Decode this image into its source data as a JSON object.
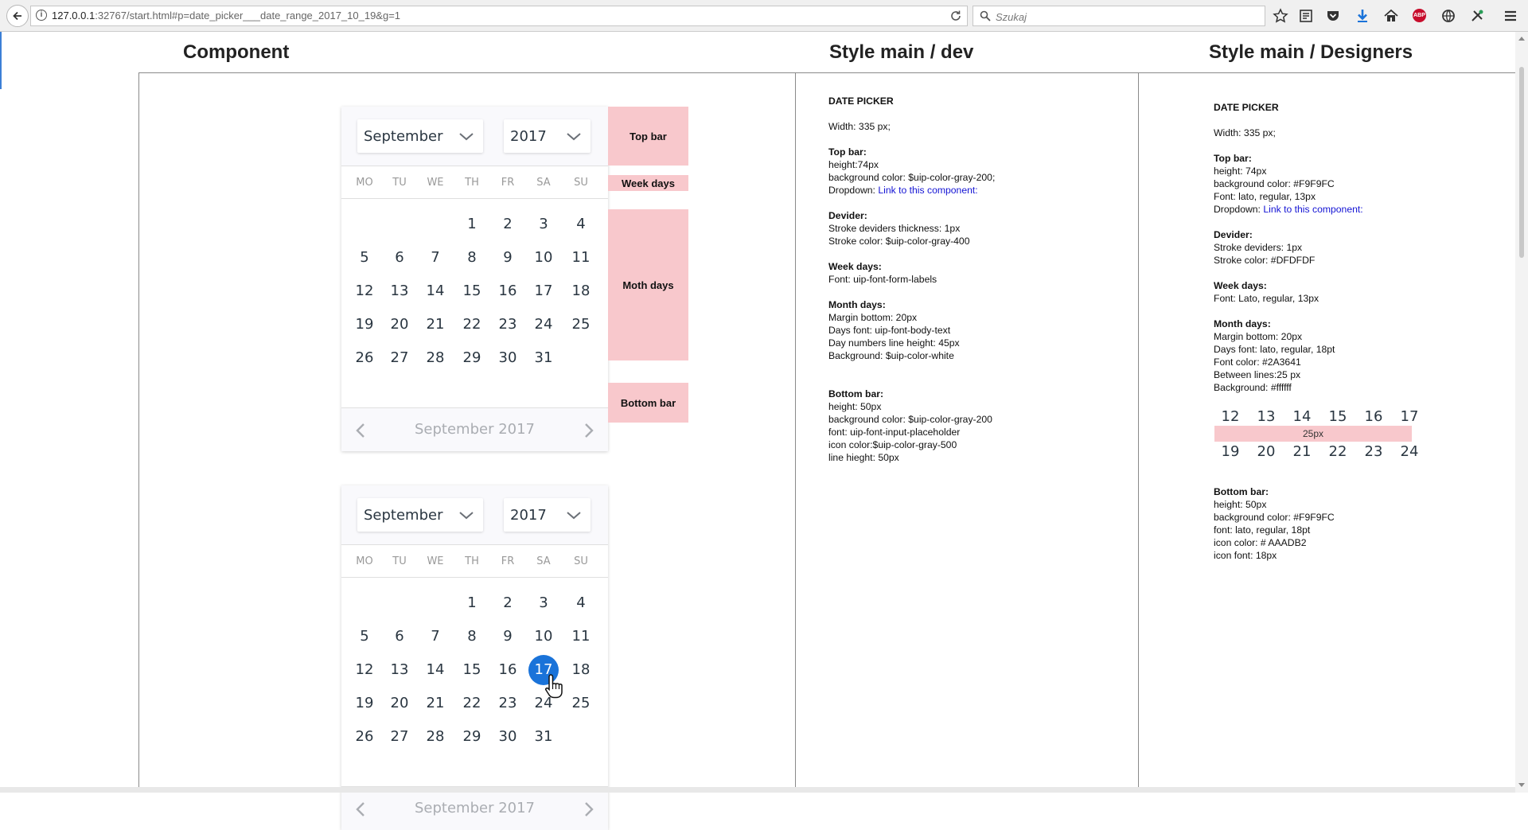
{
  "browser": {
    "url_host": "127.0.0.1",
    "url_rest": ":32767/start.html#p=date_picker___date_range_2017_10_19&g=1",
    "search_placeholder": "Szukaj",
    "icons": [
      "star-icon",
      "reader-icon",
      "pocket-icon",
      "download-icon",
      "home-icon",
      "adblock-icon",
      "vpn-icon",
      "tools-icon",
      "menu-icon"
    ],
    "adblock_label": "ABP"
  },
  "columns": {
    "component": "Component",
    "dev": "Style main / dev",
    "designers": "Style main / Designers"
  },
  "picker1": {
    "month": "September",
    "year": "2017",
    "weekdays": [
      "MO",
      "TU",
      "WE",
      "TH",
      "FR",
      "SA",
      "SU"
    ],
    "days": [
      "1",
      "2",
      "3",
      "4",
      "5",
      "6",
      "7",
      "8",
      "9",
      "10",
      "11",
      "12",
      "13",
      "14",
      "15",
      "16",
      "17",
      "18",
      "19",
      "20",
      "21",
      "22",
      "23",
      "24",
      "25",
      "26",
      "27",
      "28",
      "29",
      "30",
      "31"
    ],
    "footer": "September 2017"
  },
  "picker2": {
    "month": "September",
    "year": "2017",
    "weekdays": [
      "MO",
      "TU",
      "WE",
      "TH",
      "FR",
      "SA",
      "SU"
    ],
    "days": [
      "1",
      "2",
      "3",
      "4",
      "5",
      "6",
      "7",
      "8",
      "9",
      "10",
      "11",
      "12",
      "13",
      "14",
      "15",
      "16",
      "17",
      "18",
      "19",
      "20",
      "21",
      "22",
      "23",
      "24",
      "25",
      "26",
      "27",
      "28",
      "29",
      "30",
      "31"
    ],
    "selected": "17",
    "footer": "September 2017"
  },
  "annotations": {
    "top_bar": "Top bar",
    "week_days": "Week days",
    "month_days": "Moth days",
    "bottom_bar": "Bottom bar"
  },
  "dev_spec": {
    "title": "DATE PICKER",
    "width": "Width: 335 px;",
    "top_bar_h": "Top bar:",
    "top_bar_1": "height:74px",
    "top_bar_2": "background color: $uip-color-gray-200;",
    "top_bar_3": "Dropdown: ",
    "link": "Link to this component:",
    "devider_h": "Devider:",
    "devider_1": "Stroke deviders thickness: 1px",
    "devider_2": "Stroke color: $uip-color-gray-400",
    "week_h": "Week days:",
    "week_1": "Font: uip-font-form-labels",
    "month_h": "Month days:",
    "month_1": "Margin bottom: 20px",
    "month_2": "Days font: uip-font-body-text",
    "month_3": "Day numbers line height: 45px",
    "month_4": "Background: $uip-color-white",
    "bottom_h": "Bottom bar:",
    "bottom_1": "height: 50px",
    "bottom_2": "background color: $uip-color-gray-200",
    "bottom_3": "font: uip-font-input-placeholder",
    "bottom_4": "icon color:$uip-color-gray-500",
    "bottom_5": "line hieght: 50px"
  },
  "designer_spec": {
    "title": "DATE PICKER",
    "width": "Width: 335 px;",
    "top_bar_h": "Top bar:",
    "top_bar_1": "height: 74px",
    "top_bar_2": "background color: #F9F9FC",
    "top_bar_3": "Font: lato, regular, 13px",
    "top_bar_4": "Dropdown: ",
    "link": "Link to this component:",
    "devider_h": "Devider:",
    "devider_1": "Stroke deviders: 1px",
    "devider_2": "Stroke color: #DFDFDF",
    "week_h": "Week days:",
    "week_1": "Font: Lato, regular, 13px",
    "month_h": "Month days:",
    "month_1": "Margin bottom: 20px",
    "month_2": "Days font: lato, regular, 18pt",
    "month_3": "Font color: #2A3641",
    "month_4": "Between lines:25 px",
    "month_5": "Background: #ffffff",
    "demo_row1": [
      "12",
      "13",
      "14",
      "15",
      "16",
      "17"
    ],
    "demo_band": "25px",
    "demo_row2": [
      "19",
      "20",
      "21",
      "22",
      "23",
      "24"
    ],
    "bottom_h": "Bottom bar:",
    "bottom_1": "height: 50px",
    "bottom_2": "background color: #F9F9FC",
    "bottom_3": "font: lato, regular, 18pt",
    "bottom_4": "icon color: # AAADB2",
    "bottom_5": "icon font: 18px"
  },
  "colors": {
    "accent": "#1a73d9",
    "annotation_pink": "#f8c8cc",
    "day_text": "#2A3641",
    "bar_bg": "#F9F9FC",
    "divider": "#DFDFDF",
    "footer_text": "#AAADB2"
  }
}
